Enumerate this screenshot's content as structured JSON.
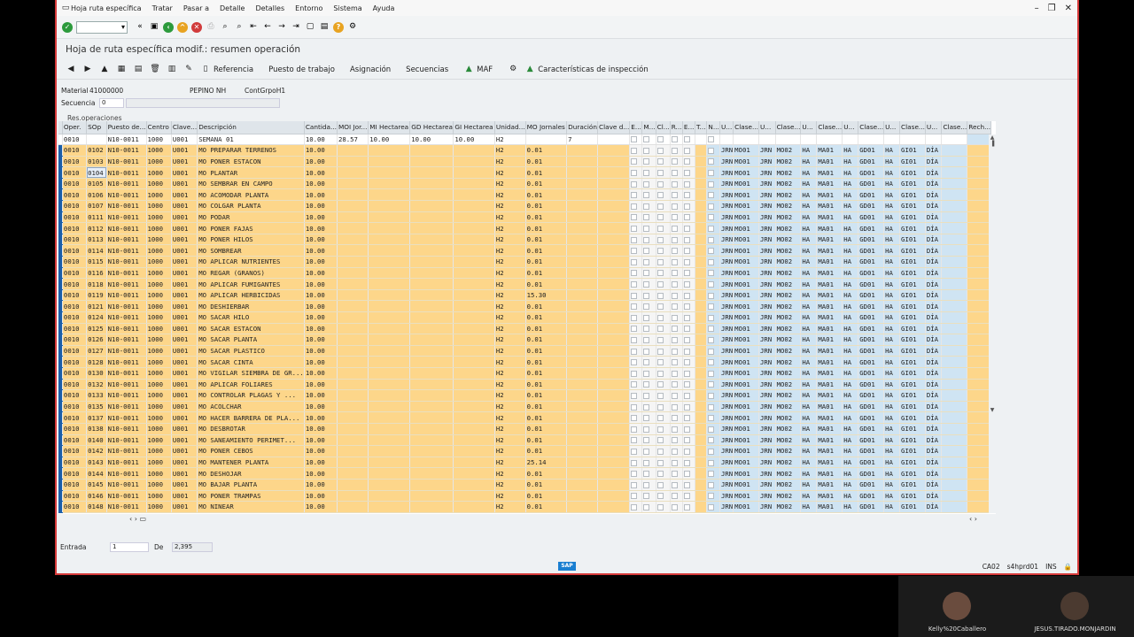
{
  "menu": [
    "Hoja ruta específica",
    "Tratar",
    "Pasar a",
    "Detalle",
    "Detalles",
    "Entorno",
    "Sistema",
    "Ayuda"
  ],
  "title": "Hoja de ruta específica modif.: resumen operación",
  "toolbar2": {
    "referencia": "Referencia",
    "puesto": "Puesto de trabajo",
    "asignacion": "Asignación",
    "secuencias": "Secuencias",
    "maf": "MAF",
    "caracteristicas": "Características de inspección"
  },
  "header": {
    "material_label": "Material",
    "material_value": "41000000",
    "material_desc": "PEPINO NH",
    "contgrp": "ContGrpoH1",
    "secuencia_label": "Secuencia",
    "secuencia_value": "0"
  },
  "group_label": "Res.operaciones",
  "columns": [
    "Oper.",
    "SOp",
    "Puesto de...",
    "Centro",
    "Clave...",
    "Descripción",
    "Cantida...",
    "MOI Jor...",
    "MI Hectarea",
    "GD Hectarea",
    "GI Hectarea",
    "Unidad...",
    "MO Jornales",
    "Duración",
    "Clave d...",
    "E...",
    "M...",
    "Cl...",
    "R...",
    "E...",
    "T...",
    "N...",
    "U...",
    "Clase...",
    "U...",
    "Clase...",
    "U...",
    "Clase...",
    "U...",
    "Clase...",
    "U...",
    "Clase...",
    "U...",
    "Clase...",
    "Rech..."
  ],
  "first_row": {
    "oper": "0010",
    "sop": "",
    "puesto": "N10-0011",
    "centro": "1000",
    "clave": "U001",
    "desc": "SEMANA 01",
    "cant": "10.00",
    "moi": "28.57",
    "mi": "10.00",
    "gd": "10.00",
    "gi": "10.00",
    "unidad": "H2",
    "mo": "",
    "dur": "7"
  },
  "rows": [
    {
      "sop": "0102",
      "desc": "MO PREPARAR TERRENOS",
      "mo": "0.01",
      "c4": "MA01",
      "c5": "GD01"
    },
    {
      "sop": "0103",
      "desc": "MO PONER ESTACON",
      "mo": "0.01",
      "c4": "MA01",
      "c5": "GD01"
    },
    {
      "sop": "0104",
      "desc": "MO PLANTAR",
      "mo": "0.01",
      "c4": "MA01",
      "c5": "GD01"
    },
    {
      "sop": "0105",
      "desc": "MO SEMBRAR EN CAMPO",
      "mo": "0.01",
      "c4": "MA01",
      "c5": "GD01"
    },
    {
      "sop": "0106",
      "desc": "MO ACOMODAR PLANTA",
      "mo": "0.01",
      "c4": "MA01",
      "c5": "GD01"
    },
    {
      "sop": "0107",
      "desc": "MO COLGAR PLANTA",
      "mo": "0.01",
      "c4": "MA01",
      "c5": "GD01"
    },
    {
      "sop": "0111",
      "desc": "MO PODAR",
      "mo": "0.01",
      "c4": "MA01",
      "c5": "GD01"
    },
    {
      "sop": "0112",
      "desc": "MO PONER FAJAS",
      "mo": "0.01",
      "c4": "MA01",
      "c5": "GD01"
    },
    {
      "sop": "0113",
      "desc": "MO PONER HILOS",
      "mo": "0.01",
      "c4": "MA01",
      "c5": "GD01"
    },
    {
      "sop": "0114",
      "desc": "MO SOMBREAR",
      "mo": "0.01",
      "c4": "MA01",
      "c5": "GD01"
    },
    {
      "sop": "0115",
      "desc": "MO APLICAR NUTRIENTES",
      "mo": "0.01",
      "c4": "MA01",
      "c5": "GD01"
    },
    {
      "sop": "0116",
      "desc": "MO REGAR (GRANOS)",
      "mo": "0.01",
      "c4": "MA01",
      "c5": "GD01"
    },
    {
      "sop": "0118",
      "desc": "MO APLICAR FUMIGANTES",
      "mo": "0.01",
      "c4": "MA01",
      "c5": "GD01"
    },
    {
      "sop": "0119",
      "desc": "MO APLICAR HERBICIDAS",
      "mo": "15.30",
      "c4": "MA01",
      "c5": "GD01"
    },
    {
      "sop": "0121",
      "desc": "MO DESHIERBAR",
      "mo": "0.01",
      "c4": "MA01",
      "c5": "GD01"
    },
    {
      "sop": "0124",
      "desc": "MO SACAR HILO",
      "mo": "0.01",
      "c4": "MA01",
      "c5": "GD01"
    },
    {
      "sop": "0125",
      "desc": "MO SACAR ESTACON",
      "mo": "0.01",
      "c4": "MA01",
      "c5": "GD01"
    },
    {
      "sop": "0126",
      "desc": "MO SACAR PLANTA",
      "mo": "0.01",
      "c4": "MA01",
      "c5": "GD01"
    },
    {
      "sop": "0127",
      "desc": "MO SACAR PLASTICO",
      "mo": "0.01",
      "c4": "MA01",
      "c5": "GD01"
    },
    {
      "sop": "0128",
      "desc": "MO SACAR CINTA",
      "mo": "0.01",
      "c4": "MA01",
      "c5": "GD01"
    },
    {
      "sop": "0130",
      "desc": "MO VIGILAR SIEMBRA DE GR...",
      "mo": "0.01",
      "c4": "MA01",
      "c5": "GD01"
    },
    {
      "sop": "0132",
      "desc": "MO APLICAR FOLIARES",
      "mo": "0.01",
      "c4": "MA01",
      "c5": "GD01"
    },
    {
      "sop": "0133",
      "desc": "MO CONTROLAR PLAGAS Y ...",
      "mo": "0.01",
      "c4": "MA01",
      "c5": "GD01"
    },
    {
      "sop": "0135",
      "desc": "MO ACOLCHAR",
      "mo": "0.01",
      "c4": "MA01",
      "c5": "GD01"
    },
    {
      "sop": "0137",
      "desc": "MO HACER BARRERA DE PLA...",
      "mo": "0.01",
      "c4": "MA01",
      "c5": "GD01"
    },
    {
      "sop": "0138",
      "desc": "MO DESBROTAR",
      "mo": "0.01",
      "c4": "MA01",
      "c5": "GD01"
    },
    {
      "sop": "0140",
      "desc": "MO SANEAMIENTO PERIMET...",
      "mo": "0.01",
      "c4": "MA01",
      "c5": "GD01"
    },
    {
      "sop": "0142",
      "desc": "MO PONER CEBOS",
      "mo": "0.01",
      "c4": "MA01",
      "c5": "GD01"
    },
    {
      "sop": "0143",
      "desc": "MO MANTENER PLANTA",
      "mo": "25.14",
      "c4": "MA01",
      "c5": "GD01"
    },
    {
      "sop": "0144",
      "desc": "MO DESHOJAR",
      "mo": "0.01",
      "c4": "MA01",
      "c5": "GD01"
    },
    {
      "sop": "0145",
      "desc": "MO BAJAR PLANTA",
      "mo": "0.01",
      "c4": "MA01",
      "c5": "GD01"
    },
    {
      "sop": "0146",
      "desc": "MO PONER TRAMPAS",
      "mo": "0.01",
      "c4": "MA01",
      "c5": "GD01"
    },
    {
      "sop": "0148",
      "desc": "MO NINEAR",
      "mo": "0.01",
      "c4": "MA01",
      "c5": "GD01"
    }
  ],
  "common": {
    "oper": "0010",
    "puesto": "N10-0011",
    "centro": "1000",
    "clave": "U001",
    "cant": "10.00",
    "unidad": "H2",
    "u": "JRN",
    "c1": "MO01",
    "c2": "MO02",
    "ha": "HA",
    "c6": "GI01",
    "dia": "DÍA"
  },
  "entrada": {
    "label": "Entrada",
    "value": "1",
    "de_label": "De",
    "total": "2,395"
  },
  "status": {
    "sap": "SAP",
    "system": "CA02",
    "server": "s4hprd01",
    "mode": "INS"
  },
  "participants": [
    {
      "name": "Kelly%20Caballero"
    },
    {
      "name": "JESUS.TIRADO.MONJARDIN"
    }
  ],
  "colors": {
    "row_yellow": "#fdd68a",
    "selected_blue": "#1b5ea8",
    "window_border": "#d63a3a"
  }
}
